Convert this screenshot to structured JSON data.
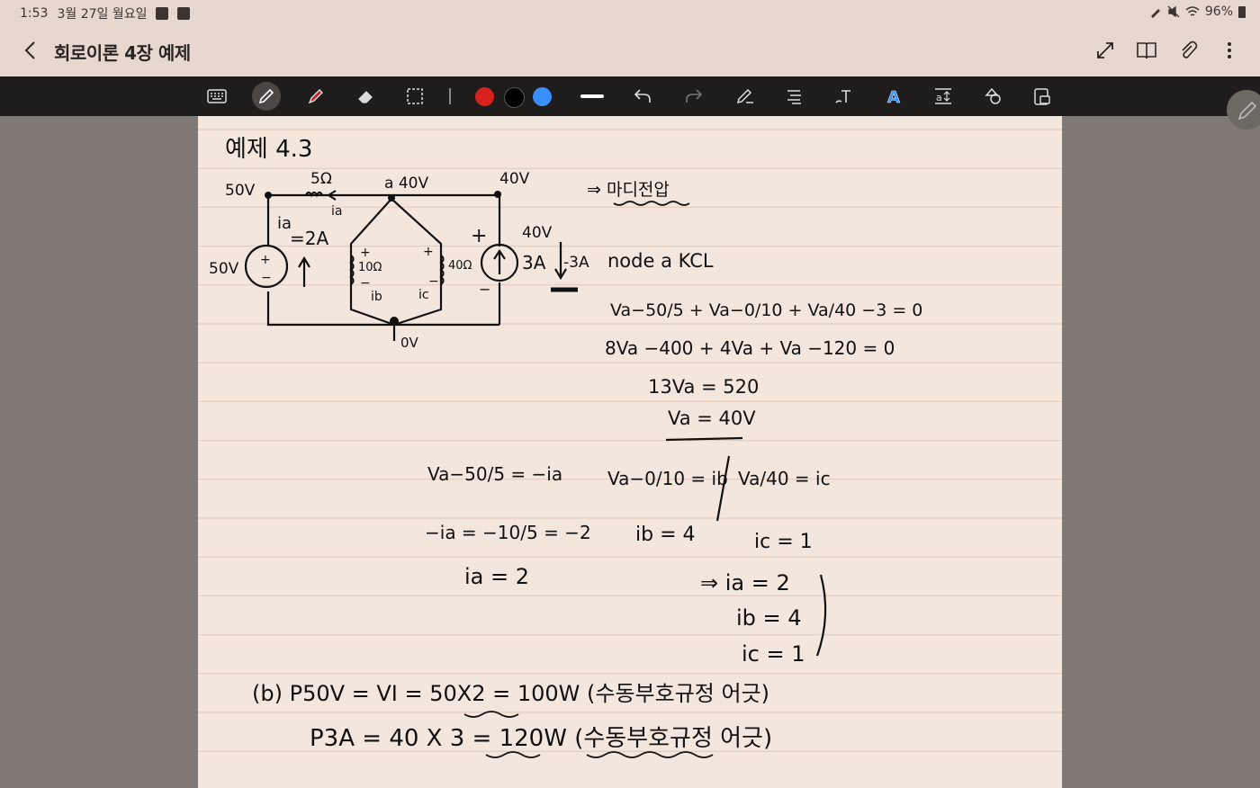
{
  "status": {
    "time": "1:53",
    "date": "3월 27일 월요일",
    "battery": "96%"
  },
  "header": {
    "title": "회로이론 4장 예제"
  },
  "icons": {
    "back": "chevron-left-icon",
    "expand": "expand-icon",
    "book": "book-view-icon",
    "attach": "paperclip-icon",
    "more": "more-vert-icon"
  },
  "toolbar": {
    "tools": [
      "keyboard",
      "pen",
      "highlighter",
      "eraser",
      "lasso",
      "undo",
      "redo",
      "pen-settings",
      "text-align",
      "handwriting-to-text",
      "text-style",
      "text-fit",
      "shapes",
      "lock"
    ],
    "colors": [
      "#d8201c",
      "#000000",
      "#3a8fff"
    ],
    "active_tool": "pen"
  },
  "note": {
    "heading": "예제 4.3",
    "circuit": {
      "node_left": "50V",
      "source_left": "50V",
      "r1": "5Ω",
      "node_a": "a 40V",
      "node_right": "40V",
      "source_right_v": "40V",
      "ia_label": "ia",
      "ia_value": "=2A",
      "r2": "10Ω",
      "r3": "40Ω",
      "ib": "ib",
      "ic": "ic",
      "source_current": "3A",
      "neg_current": "-3A",
      "ground": "0V"
    },
    "method": "⇒ 마디전압",
    "kcl_title": "node a KCL",
    "eq1": "Va−50/5 + Va−0/10 + Va/40 −3 = 0",
    "eq2": "8Va −400 + 4Va + Va −120 = 0",
    "eq3": "13Va = 520",
    "eq4": "Va = 40V",
    "sol_a1": "Va−50/5 = −ia",
    "sol_a2": "−ia = −10/5 = −2",
    "sol_a3": "ia = 2",
    "sol_b1": "Va−0/10 = ib",
    "sol_b2": "ib = 4",
    "sol_c1": "Va/40 = ic",
    "sol_c2": "ic = 1",
    "summary": [
      "⇒ ia = 2",
      "ib = 4",
      "ic = 1"
    ],
    "power1": "(b) P50V = VI = 50X2 = 100W (수동부호규정 어긋)",
    "power2": "P3A = 40 X 3 = 120W (수동부호규정 어긋)"
  }
}
